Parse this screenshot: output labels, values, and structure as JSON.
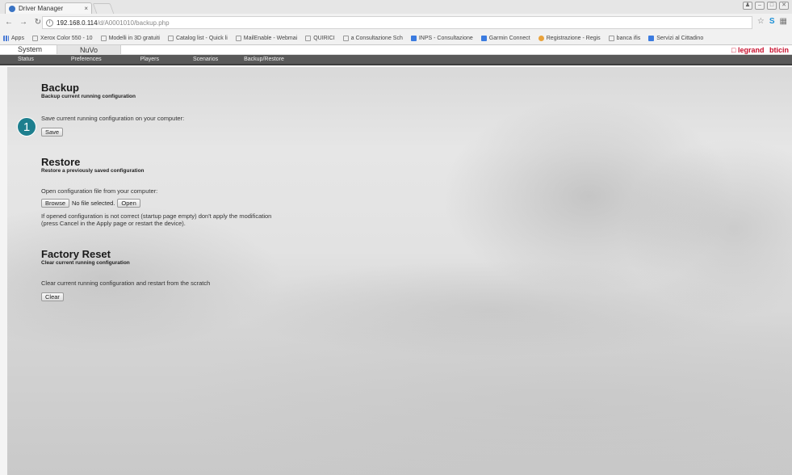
{
  "browser": {
    "tab_title": "Driver Manager",
    "tab_close": "×",
    "url_host": "192.168.0.114",
    "url_path": "/d/A0001010/backup.php",
    "bookmarks": [
      "Apps",
      "Xerox Color 550 - 10",
      "Modelli in 3D gratuiti",
      "Catalog list - Quick li",
      "MailEnable - Webmai",
      "QUIRICI",
      "a Consultazione Sch",
      "INPS - Consultazione",
      "Garmin Connect",
      "Registrazione - Regis",
      "banca ifis",
      "Servizi al Cittadino"
    ]
  },
  "app": {
    "top_tabs": [
      "System",
      "NuVo"
    ],
    "brand_legrand": "legrand",
    "brand_bticino": "bticin",
    "subnav": [
      "Status",
      "Preferences",
      "Players",
      "Scenarios",
      "Backup/Restore"
    ]
  },
  "backup": {
    "title": "Backup",
    "subtitle": "Backup current running configuration",
    "text": "Save current running configuration on your computer:",
    "save_label": "Save"
  },
  "restore": {
    "title": "Restore",
    "subtitle": "Restore a previously saved configuration",
    "text": "Open configuration file from your computer:",
    "browse_label": "Browse",
    "file_status": "No file selected.",
    "open_label": "Open",
    "note_line1": "If opened configuration is not correct (startup page empty) don't apply the modification",
    "note_line2": "(press Cancel in the Apply page or restart the device)."
  },
  "factory_reset": {
    "title": "Factory Reset",
    "subtitle": "Clear current running configuration",
    "text": "Clear current running configuration and restart from the scratch",
    "clear_label": "Clear"
  },
  "step_badge": "1"
}
